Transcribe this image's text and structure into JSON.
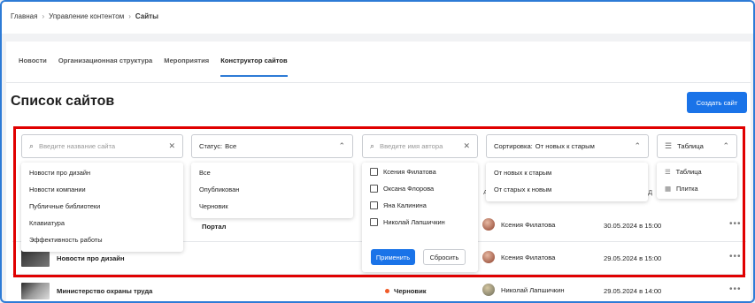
{
  "breadcrumbs": [
    "Главная",
    "Управление контентом",
    "Сайты"
  ],
  "tabs": [
    "Новости",
    "Организационная структура",
    "Мероприятия",
    "Конструктор сайтов"
  ],
  "page_title": "Список сайтов",
  "create_button": "Создать сайт",
  "filters": {
    "search_site_placeholder": "Введите название сайта",
    "status_label": "Статус:",
    "status_value": "Все",
    "author_placeholder": "Введите имя автора",
    "sort_label": "Сортировка:",
    "sort_value": "От новых к старым",
    "view_value": "Таблица"
  },
  "site_dropdown": [
    "Новости про дизайн",
    "Новости компании",
    "Публичные библиотеки",
    "Клавиатура",
    "Эффективность работы"
  ],
  "status_dropdown": [
    "Все",
    "Опубликован",
    "Черновик"
  ],
  "author_dropdown": {
    "items": [
      "Ксения Филатова",
      "Оксана Флорова",
      "Яна Калинина",
      "Николай Лапшичкин"
    ],
    "apply": "Применить",
    "reset": "Сбросить"
  },
  "sort_dropdown": [
    "От новых к старым",
    "От старых к новым"
  ],
  "view_dropdown": [
    "Таблица",
    "Плитка"
  ],
  "table_headers": {
    "author_partial": "А",
    "date_partial": "Д"
  },
  "rows": [
    {
      "name": "",
      "status": "Портал",
      "author": "Ксения Филатова",
      "date": "30.05.2024 в 15:00"
    },
    {
      "name": "Новости про дизайн",
      "status": "",
      "author": "Ксения Филатова",
      "date": "29.05.2024 в 15:00"
    },
    {
      "name": "Министерство охраны труда",
      "status": "Черновик",
      "author": "Николай Лапшичкин",
      "date": "29.05.2024 в 14:00"
    }
  ],
  "more_glyph": "•••",
  "colors": {
    "accent": "#1a73e8",
    "highlight": "#e00000",
    "draft_dot": "#f05a28"
  }
}
